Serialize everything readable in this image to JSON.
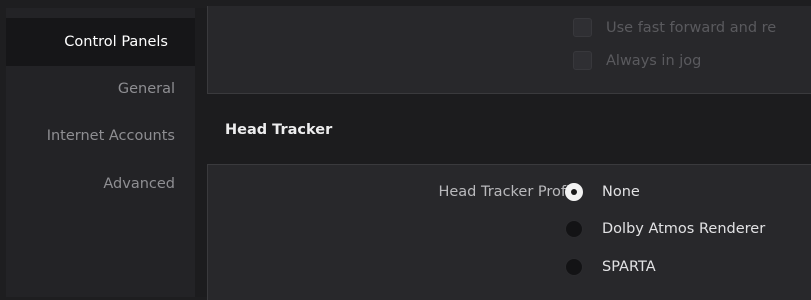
{
  "sidebar": {
    "items": [
      {
        "label": "Control Panels",
        "active": true
      },
      {
        "label": "General",
        "active": false
      },
      {
        "label": "Internet Accounts",
        "active": false
      },
      {
        "label": "Advanced",
        "active": false
      }
    ]
  },
  "transport_options": {
    "fast_forward_label": "Use fast forward and re",
    "always_jog_label": "Always in jog"
  },
  "head_tracker": {
    "section_title": "Head Tracker",
    "profile_label": "Head Tracker Profile",
    "options": [
      {
        "label": "None",
        "selected": true
      },
      {
        "label": "Dolby Atmos Renderer",
        "selected": false
      },
      {
        "label": "SPARTA",
        "selected": false
      }
    ]
  }
}
